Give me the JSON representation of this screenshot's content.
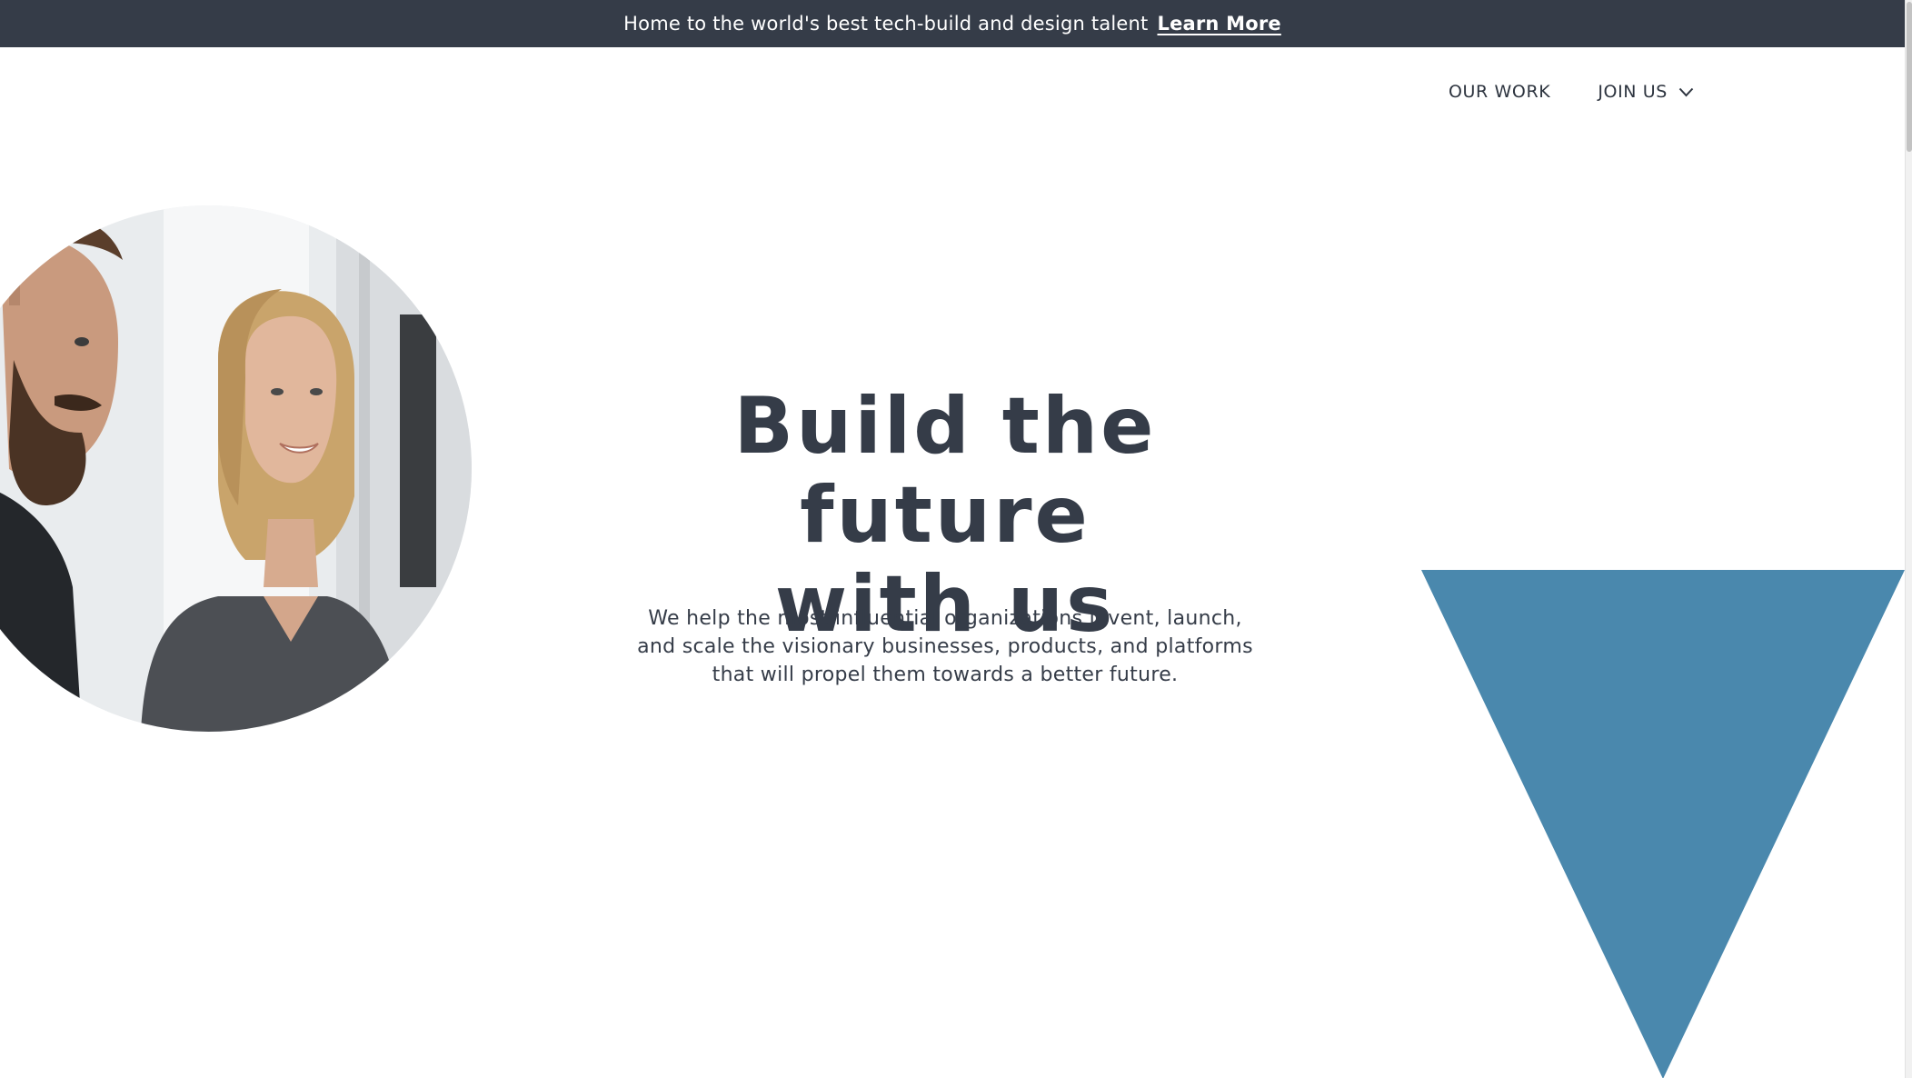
{
  "banner": {
    "text": "Home to the world's best tech-build and design talent",
    "link_label": "Learn More"
  },
  "nav": {
    "items": [
      {
        "label": "OUR WORK"
      },
      {
        "label": "JOIN US",
        "icon": "chevron-down-icon"
      }
    ]
  },
  "hero": {
    "title_line1": "Build the future",
    "title_line2": "with us",
    "subtitle_line1": "We help the most influential organizations invent, launch,",
    "subtitle_line2": "and scale the visionary businesses, products, and platforms",
    "subtitle_line3": "that will propel them towards a better future.",
    "photo": "team-photo"
  },
  "colors": {
    "banner_bg": "#353c48",
    "text": "#353c48",
    "accent_triangle": "#4a88ad",
    "background": "#ffffff"
  }
}
